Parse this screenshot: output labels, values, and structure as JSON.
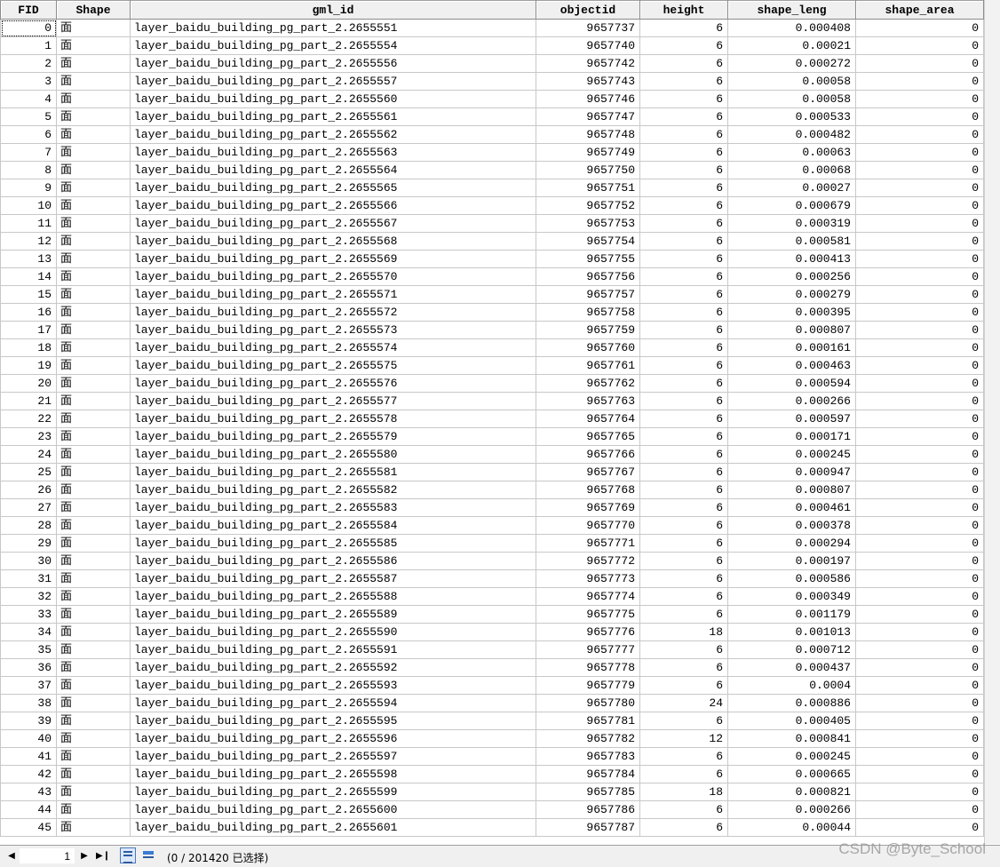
{
  "columns": [
    "FID",
    "Shape",
    "gml_id",
    "objectid",
    "height",
    "shape_leng",
    "shape_area"
  ],
  "rows": [
    {
      "fid": "0",
      "shape": "面",
      "gml_id": "layer_baidu_building_pg_part_2.2655551",
      "objectid": "9657737",
      "height": "6",
      "shape_leng": "0.000408",
      "shape_area": "0"
    },
    {
      "fid": "1",
      "shape": "面",
      "gml_id": "layer_baidu_building_pg_part_2.2655554",
      "objectid": "9657740",
      "height": "6",
      "shape_leng": "0.00021",
      "shape_area": "0"
    },
    {
      "fid": "2",
      "shape": "面",
      "gml_id": "layer_baidu_building_pg_part_2.2655556",
      "objectid": "9657742",
      "height": "6",
      "shape_leng": "0.000272",
      "shape_area": "0"
    },
    {
      "fid": "3",
      "shape": "面",
      "gml_id": "layer_baidu_building_pg_part_2.2655557",
      "objectid": "9657743",
      "height": "6",
      "shape_leng": "0.00058",
      "shape_area": "0"
    },
    {
      "fid": "4",
      "shape": "面",
      "gml_id": "layer_baidu_building_pg_part_2.2655560",
      "objectid": "9657746",
      "height": "6",
      "shape_leng": "0.00058",
      "shape_area": "0"
    },
    {
      "fid": "5",
      "shape": "面",
      "gml_id": "layer_baidu_building_pg_part_2.2655561",
      "objectid": "9657747",
      "height": "6",
      "shape_leng": "0.000533",
      "shape_area": "0"
    },
    {
      "fid": "6",
      "shape": "面",
      "gml_id": "layer_baidu_building_pg_part_2.2655562",
      "objectid": "9657748",
      "height": "6",
      "shape_leng": "0.000482",
      "shape_area": "0"
    },
    {
      "fid": "7",
      "shape": "面",
      "gml_id": "layer_baidu_building_pg_part_2.2655563",
      "objectid": "9657749",
      "height": "6",
      "shape_leng": "0.00063",
      "shape_area": "0"
    },
    {
      "fid": "8",
      "shape": "面",
      "gml_id": "layer_baidu_building_pg_part_2.2655564",
      "objectid": "9657750",
      "height": "6",
      "shape_leng": "0.00068",
      "shape_area": "0"
    },
    {
      "fid": "9",
      "shape": "面",
      "gml_id": "layer_baidu_building_pg_part_2.2655565",
      "objectid": "9657751",
      "height": "6",
      "shape_leng": "0.00027",
      "shape_area": "0"
    },
    {
      "fid": "10",
      "shape": "面",
      "gml_id": "layer_baidu_building_pg_part_2.2655566",
      "objectid": "9657752",
      "height": "6",
      "shape_leng": "0.000679",
      "shape_area": "0"
    },
    {
      "fid": "11",
      "shape": "面",
      "gml_id": "layer_baidu_building_pg_part_2.2655567",
      "objectid": "9657753",
      "height": "6",
      "shape_leng": "0.000319",
      "shape_area": "0"
    },
    {
      "fid": "12",
      "shape": "面",
      "gml_id": "layer_baidu_building_pg_part_2.2655568",
      "objectid": "9657754",
      "height": "6",
      "shape_leng": "0.000581",
      "shape_area": "0"
    },
    {
      "fid": "13",
      "shape": "面",
      "gml_id": "layer_baidu_building_pg_part_2.2655569",
      "objectid": "9657755",
      "height": "6",
      "shape_leng": "0.000413",
      "shape_area": "0"
    },
    {
      "fid": "14",
      "shape": "面",
      "gml_id": "layer_baidu_building_pg_part_2.2655570",
      "objectid": "9657756",
      "height": "6",
      "shape_leng": "0.000256",
      "shape_area": "0"
    },
    {
      "fid": "15",
      "shape": "面",
      "gml_id": "layer_baidu_building_pg_part_2.2655571",
      "objectid": "9657757",
      "height": "6",
      "shape_leng": "0.000279",
      "shape_area": "0"
    },
    {
      "fid": "16",
      "shape": "面",
      "gml_id": "layer_baidu_building_pg_part_2.2655572",
      "objectid": "9657758",
      "height": "6",
      "shape_leng": "0.000395",
      "shape_area": "0"
    },
    {
      "fid": "17",
      "shape": "面",
      "gml_id": "layer_baidu_building_pg_part_2.2655573",
      "objectid": "9657759",
      "height": "6",
      "shape_leng": "0.000807",
      "shape_area": "0"
    },
    {
      "fid": "18",
      "shape": "面",
      "gml_id": "layer_baidu_building_pg_part_2.2655574",
      "objectid": "9657760",
      "height": "6",
      "shape_leng": "0.000161",
      "shape_area": "0"
    },
    {
      "fid": "19",
      "shape": "面",
      "gml_id": "layer_baidu_building_pg_part_2.2655575",
      "objectid": "9657761",
      "height": "6",
      "shape_leng": "0.000463",
      "shape_area": "0"
    },
    {
      "fid": "20",
      "shape": "面",
      "gml_id": "layer_baidu_building_pg_part_2.2655576",
      "objectid": "9657762",
      "height": "6",
      "shape_leng": "0.000594",
      "shape_area": "0"
    },
    {
      "fid": "21",
      "shape": "面",
      "gml_id": "layer_baidu_building_pg_part_2.2655577",
      "objectid": "9657763",
      "height": "6",
      "shape_leng": "0.000266",
      "shape_area": "0"
    },
    {
      "fid": "22",
      "shape": "面",
      "gml_id": "layer_baidu_building_pg_part_2.2655578",
      "objectid": "9657764",
      "height": "6",
      "shape_leng": "0.000597",
      "shape_area": "0"
    },
    {
      "fid": "23",
      "shape": "面",
      "gml_id": "layer_baidu_building_pg_part_2.2655579",
      "objectid": "9657765",
      "height": "6",
      "shape_leng": "0.000171",
      "shape_area": "0"
    },
    {
      "fid": "24",
      "shape": "面",
      "gml_id": "layer_baidu_building_pg_part_2.2655580",
      "objectid": "9657766",
      "height": "6",
      "shape_leng": "0.000245",
      "shape_area": "0"
    },
    {
      "fid": "25",
      "shape": "面",
      "gml_id": "layer_baidu_building_pg_part_2.2655581",
      "objectid": "9657767",
      "height": "6",
      "shape_leng": "0.000947",
      "shape_area": "0"
    },
    {
      "fid": "26",
      "shape": "面",
      "gml_id": "layer_baidu_building_pg_part_2.2655582",
      "objectid": "9657768",
      "height": "6",
      "shape_leng": "0.000807",
      "shape_area": "0"
    },
    {
      "fid": "27",
      "shape": "面",
      "gml_id": "layer_baidu_building_pg_part_2.2655583",
      "objectid": "9657769",
      "height": "6",
      "shape_leng": "0.000461",
      "shape_area": "0"
    },
    {
      "fid": "28",
      "shape": "面",
      "gml_id": "layer_baidu_building_pg_part_2.2655584",
      "objectid": "9657770",
      "height": "6",
      "shape_leng": "0.000378",
      "shape_area": "0"
    },
    {
      "fid": "29",
      "shape": "面",
      "gml_id": "layer_baidu_building_pg_part_2.2655585",
      "objectid": "9657771",
      "height": "6",
      "shape_leng": "0.000294",
      "shape_area": "0"
    },
    {
      "fid": "30",
      "shape": "面",
      "gml_id": "layer_baidu_building_pg_part_2.2655586",
      "objectid": "9657772",
      "height": "6",
      "shape_leng": "0.000197",
      "shape_area": "0"
    },
    {
      "fid": "31",
      "shape": "面",
      "gml_id": "layer_baidu_building_pg_part_2.2655587",
      "objectid": "9657773",
      "height": "6",
      "shape_leng": "0.000586",
      "shape_area": "0"
    },
    {
      "fid": "32",
      "shape": "面",
      "gml_id": "layer_baidu_building_pg_part_2.2655588",
      "objectid": "9657774",
      "height": "6",
      "shape_leng": "0.000349",
      "shape_area": "0"
    },
    {
      "fid": "33",
      "shape": "面",
      "gml_id": "layer_baidu_building_pg_part_2.2655589",
      "objectid": "9657775",
      "height": "6",
      "shape_leng": "0.001179",
      "shape_area": "0"
    },
    {
      "fid": "34",
      "shape": "面",
      "gml_id": "layer_baidu_building_pg_part_2.2655590",
      "objectid": "9657776",
      "height": "18",
      "shape_leng": "0.001013",
      "shape_area": "0"
    },
    {
      "fid": "35",
      "shape": "面",
      "gml_id": "layer_baidu_building_pg_part_2.2655591",
      "objectid": "9657777",
      "height": "6",
      "shape_leng": "0.000712",
      "shape_area": "0"
    },
    {
      "fid": "36",
      "shape": "面",
      "gml_id": "layer_baidu_building_pg_part_2.2655592",
      "objectid": "9657778",
      "height": "6",
      "shape_leng": "0.000437",
      "shape_area": "0"
    },
    {
      "fid": "37",
      "shape": "面",
      "gml_id": "layer_baidu_building_pg_part_2.2655593",
      "objectid": "9657779",
      "height": "6",
      "shape_leng": "0.0004",
      "shape_area": "0"
    },
    {
      "fid": "38",
      "shape": "面",
      "gml_id": "layer_baidu_building_pg_part_2.2655594",
      "objectid": "9657780",
      "height": "24",
      "shape_leng": "0.000886",
      "shape_area": "0"
    },
    {
      "fid": "39",
      "shape": "面",
      "gml_id": "layer_baidu_building_pg_part_2.2655595",
      "objectid": "9657781",
      "height": "6",
      "shape_leng": "0.000405",
      "shape_area": "0"
    },
    {
      "fid": "40",
      "shape": "面",
      "gml_id": "layer_baidu_building_pg_part_2.2655596",
      "objectid": "9657782",
      "height": "12",
      "shape_leng": "0.000841",
      "shape_area": "0"
    },
    {
      "fid": "41",
      "shape": "面",
      "gml_id": "layer_baidu_building_pg_part_2.2655597",
      "objectid": "9657783",
      "height": "6",
      "shape_leng": "0.000245",
      "shape_area": "0"
    },
    {
      "fid": "42",
      "shape": "面",
      "gml_id": "layer_baidu_building_pg_part_2.2655598",
      "objectid": "9657784",
      "height": "6",
      "shape_leng": "0.000665",
      "shape_area": "0"
    },
    {
      "fid": "43",
      "shape": "面",
      "gml_id": "layer_baidu_building_pg_part_2.2655599",
      "objectid": "9657785",
      "height": "18",
      "shape_leng": "0.000821",
      "shape_area": "0"
    },
    {
      "fid": "44",
      "shape": "面",
      "gml_id": "layer_baidu_building_pg_part_2.2655600",
      "objectid": "9657786",
      "height": "6",
      "shape_leng": "0.000266",
      "shape_area": "0"
    },
    {
      "fid": "45",
      "shape": "面",
      "gml_id": "layer_baidu_building_pg_part_2.2655601",
      "objectid": "9657787",
      "height": "6",
      "shape_leng": "0.00044",
      "shape_area": "0"
    }
  ],
  "statusbar": {
    "current_record": "1",
    "selection_text": "(0 / 201420 已选择)",
    "nav_first_icon": "first-record-icon",
    "nav_prev_icon": "prev-record-icon",
    "nav_next_icon": "next-record-icon",
    "nav_last_icon": "last-record-icon",
    "view_all_icon": "show-all-records-icon",
    "view_selected_icon": "show-selected-records-icon"
  },
  "watermark": "CSDN @Byte_School",
  "colors": {
    "header_bg": "#f0f0f0",
    "grid_line": "#c8c8c8",
    "statusbar_bg": "#f0f0f0",
    "active_view_button": "#dbe8fb"
  }
}
